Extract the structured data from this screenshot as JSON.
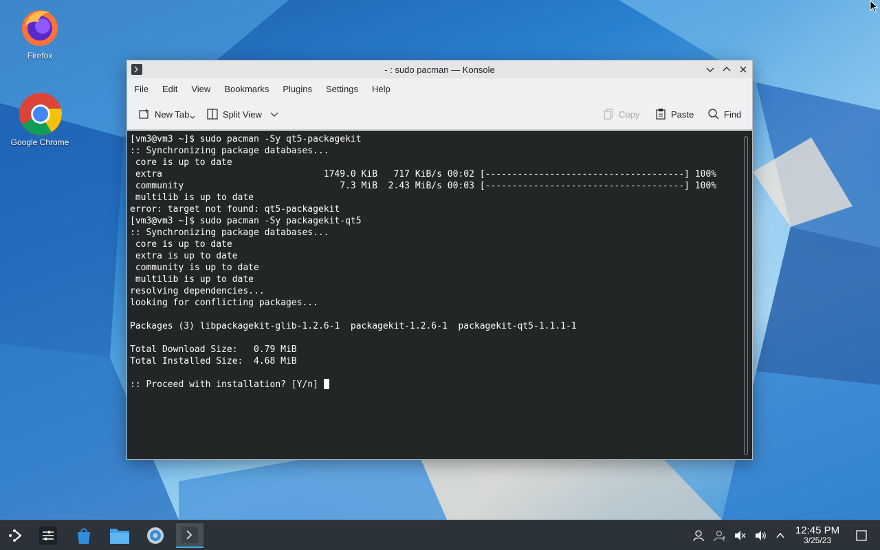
{
  "desktop": {
    "icons": [
      {
        "label": "Firefox",
        "icon": "firefox-icon"
      },
      {
        "label": "Google Chrome",
        "icon": "chrome-icon"
      }
    ]
  },
  "window": {
    "title": "- : sudo pacman — Konsole",
    "menu": [
      "File",
      "Edit",
      "View",
      "Bookmarks",
      "Plugins",
      "Settings",
      "Help"
    ],
    "toolbar": {
      "new_tab": "New Tab",
      "split_view": "Split View",
      "copy": "Copy",
      "paste": "Paste",
      "find": "Find"
    },
    "terminal_lines": [
      "[vm3@vm3 ~]$ sudo pacman -Sy qt5-packagekit",
      ":: Synchronizing package databases...",
      " core is up to date",
      " extra                              1749.0 KiB   717 KiB/s 00:02 [-------------------------------------] 100%",
      " community                             7.3 MiB  2.43 MiB/s 00:03 [-------------------------------------] 100%",
      " multilib is up to date",
      "error: target not found: qt5-packagekit",
      "[vm3@vm3 ~]$ sudo pacman -Sy packagekit-qt5",
      ":: Synchronizing package databases...",
      " core is up to date",
      " extra is up to date",
      " community is up to date",
      " multilib is up to date",
      "resolving dependencies...",
      "looking for conflicting packages...",
      "",
      "Packages (3) libpackagekit-glib-1.2.6-1  packagekit-1.2.6-1  packagekit-qt5-1.1.1-1",
      "",
      "Total Download Size:   0.79 MiB",
      "Total Installed Size:  4.68 MiB",
      "",
      ":: Proceed with installation? [Y/n] "
    ]
  },
  "taskbar": {
    "apps": [
      "app-launcher-icon",
      "pager-icon",
      "discover-icon",
      "dolphin-icon",
      "system-settings-icon",
      "konsole-icon"
    ],
    "tray": [
      "user-icon",
      "users-icon",
      "volume-muted-icon",
      "volume-icon",
      "expand-tray-icon"
    ],
    "time": "12:45 PM",
    "date": "3/25/23"
  },
  "colors": {
    "terminal_bg": "#232627",
    "taskbar_bg": "#2b3338",
    "accent": "#3daee9"
  }
}
